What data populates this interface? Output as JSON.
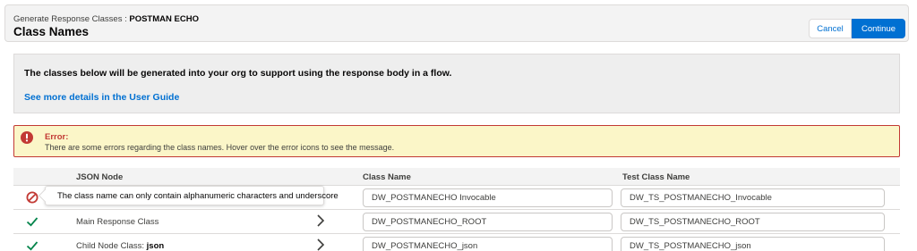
{
  "header": {
    "subtitle_prefix": "Generate Response Classes : ",
    "subtitle_name": "POSTMAN ECHO",
    "title": "Class Names",
    "cancel_label": "Cancel",
    "continue_label": "Continue"
  },
  "info": {
    "message": "The classes below will be generated into your org to support using the response body in a flow.",
    "link_text": "See more details in the User Guide"
  },
  "error": {
    "icon": "error-icon",
    "title": "Error:",
    "message": "There are some errors regarding the class names. Hover over the error icons to see the message."
  },
  "table": {
    "headers": {
      "json_node": "JSON Node",
      "class_name": "Class Name",
      "test_class_name": "Test Class Name"
    },
    "rows": [
      {
        "status": "error",
        "node_label": "",
        "node_bold": "",
        "class_name": "DW_POSTMANECHO Invocable",
        "test_class_name": "DW_TS_POSTMANECHO_Invocable"
      },
      {
        "status": "ok",
        "node_label": "Main Response Class",
        "node_bold": "",
        "class_name": "DW_POSTMANECHO_ROOT",
        "test_class_name": "DW_TS_POSTMANECHO_ROOT"
      },
      {
        "status": "ok",
        "node_label": "Child Node Class: ",
        "node_bold": "json",
        "class_name": "DW_POSTMANECHO_json",
        "test_class_name": "DW_TS_POSTMANECHO_json"
      }
    ]
  },
  "tooltip": {
    "text": "The class name can only contain alphanumeric characters and underscore"
  },
  "colors": {
    "brand": "#0070d2",
    "error": "#c23934",
    "success": "#04844b",
    "warning_bg": "#fbf6c8"
  }
}
